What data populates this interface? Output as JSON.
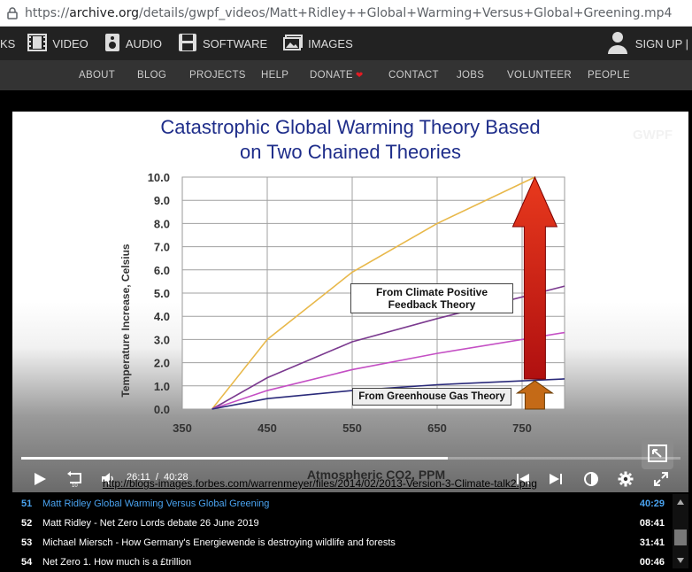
{
  "browser": {
    "url_prefix": "https://",
    "url_host": "archive.org",
    "url_path": "/details/gwpf_videos/Matt+Ridley++Global+Warming+Versus+Global+Greening.mp4"
  },
  "topnav": {
    "cut_label": "KS",
    "items": [
      "VIDEO",
      "AUDIO",
      "SOFTWARE",
      "IMAGES"
    ],
    "signup": "SIGN UP |"
  },
  "subnav": {
    "items": [
      "ABOUT",
      "BLOG",
      "PROJECTS",
      "HELP",
      "DONATE",
      "CONTACT",
      "JOBS",
      "VOLUNTEER",
      "PEOPLE"
    ]
  },
  "slide": {
    "title_line1": "Catastrophic Global Warming Theory Based",
    "title_line2": "on Two Chained Theories",
    "watermark": "GWPF",
    "box1_line1": "From Climate Positive",
    "box1_line2": "Feedback Theory",
    "box2": "From Greenhouse Gas Theory"
  },
  "chart_data": {
    "type": "line",
    "xlabel": "Atmospheric CO2, PPM",
    "ylabel": "Temperature Increase, Celsius",
    "xlim": [
      350,
      800
    ],
    "ylim": [
      0,
      10
    ],
    "x_ticks": [
      "350",
      "450",
      "550",
      "650",
      "750"
    ],
    "y_ticks": [
      "0.0",
      "1.0",
      "2.0",
      "3.0",
      "4.0",
      "5.0",
      "6.0",
      "7.0",
      "8.0",
      "9.0",
      "10.0"
    ],
    "series": [
      {
        "color": "#e8b84a",
        "x": [
          385,
          450,
          550,
          650,
          765
        ],
        "y": [
          0,
          3.0,
          5.9,
          8.0,
          10.0
        ]
      },
      {
        "color": "#7b3a8f",
        "x": [
          385,
          450,
          550,
          650,
          800
        ],
        "y": [
          0,
          1.35,
          2.9,
          3.9,
          5.3
        ]
      },
      {
        "color": "#c44fc4",
        "x": [
          385,
          450,
          550,
          650,
          800
        ],
        "y": [
          0,
          0.8,
          1.7,
          2.4,
          3.3
        ]
      },
      {
        "color": "#2a2a7a",
        "x": [
          385,
          450,
          550,
          650,
          800
        ],
        "y": [
          0,
          0.45,
          0.8,
          1.05,
          1.3
        ]
      }
    ],
    "arrow_colors": {
      "top": "#e8391d",
      "bottom": "#c46a17"
    }
  },
  "player": {
    "current": "26:11",
    "separator": "/",
    "total": "40:28",
    "progress": 0.647,
    "link": "http://blogs-images.forbes.com/warrenmeyer/files/2014/02/2013-Version-3-Climate-talk2.png"
  },
  "playlist": [
    {
      "num": "51",
      "title": "Matt Ridley Global Warming Versus Global Greening",
      "dur": "40:29",
      "active": true
    },
    {
      "num": "52",
      "title": "Matt Ridley - Net Zero Lords debate 26 June 2019",
      "dur": "08:41",
      "active": false
    },
    {
      "num": "53",
      "title": "Michael Miersch - How Germany's Energiewende is destroying wildlife and forests",
      "dur": "31:41",
      "active": false
    },
    {
      "num": "54",
      "title": "Net Zero 1. How much is a £trillion",
      "dur": "00:46",
      "active": false
    }
  ]
}
